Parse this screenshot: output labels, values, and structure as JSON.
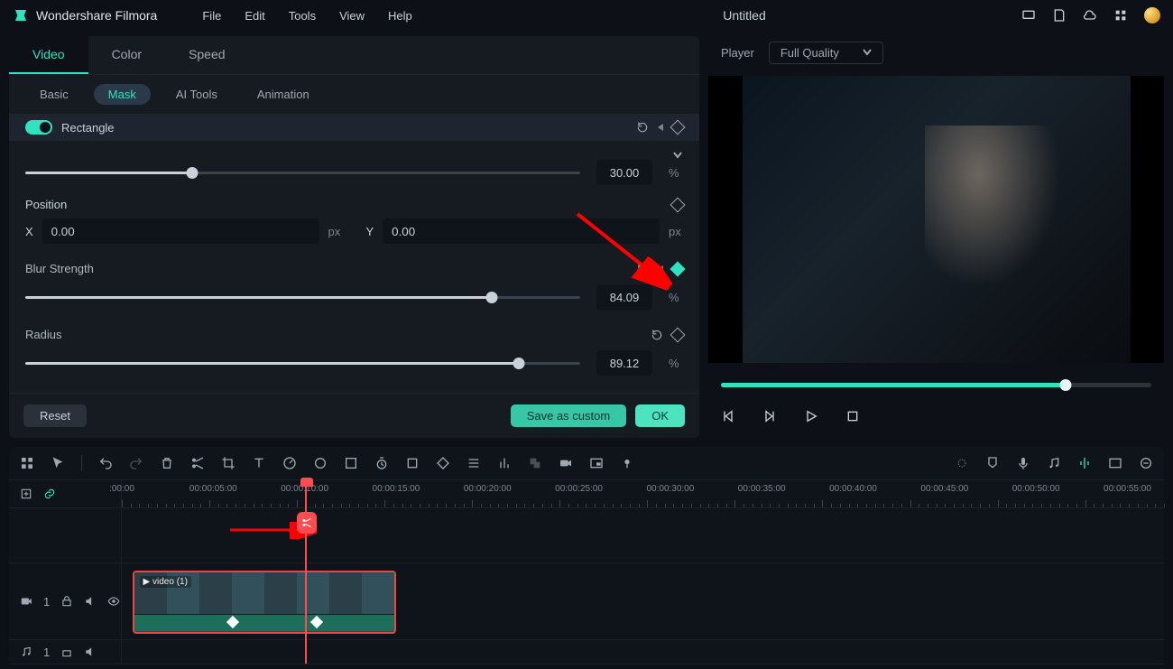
{
  "app": {
    "title": "Wondershare Filmora",
    "document": "Untitled"
  },
  "menubar": [
    "File",
    "Edit",
    "Tools",
    "View",
    "Help"
  ],
  "player": {
    "label": "Player",
    "quality": "Full Quality",
    "progress_percent": 80
  },
  "panel": {
    "major_tabs": [
      "Video",
      "Color",
      "Speed"
    ],
    "major_active": 0,
    "sub_tabs": [
      "Basic",
      "Mask",
      "AI Tools",
      "Animation"
    ],
    "sub_active": 1,
    "section_title": "Rectangle",
    "rotate": {
      "value": "30.00",
      "unit": "%",
      "percent": 30
    },
    "position": {
      "label": "Position",
      "x_label": "X",
      "y_label": "Y",
      "x": "0.00",
      "y": "0.00",
      "unit": "px"
    },
    "blur": {
      "label": "Blur Strength",
      "value": "84.09",
      "unit": "%",
      "percent": 84
    },
    "radius": {
      "label": "Radius",
      "value": "89.12",
      "unit": "%",
      "percent": 89
    },
    "buttons": {
      "reset": "Reset",
      "save_custom": "Save as custom",
      "ok": "OK"
    }
  },
  "timeline": {
    "ruler_labels": [
      ":00:00",
      "00:00:05:00",
      "00:00:10:00",
      "00:00:15:00",
      "00:00:20:00",
      "00:00:25:00",
      "00:00:30:00",
      "00:00:35:00",
      "00:00:40:00",
      "00:00:45:00",
      "00:00:50:00",
      "00:00:55:00"
    ],
    "playhead_percent": 18.5,
    "clip": {
      "label": "▶ video (1)",
      "start_percent": 1,
      "width_percent": 25,
      "kf1_percent": 38,
      "kf2_percent": 70
    },
    "video_track_index": "1",
    "audio_track_index": "1"
  }
}
